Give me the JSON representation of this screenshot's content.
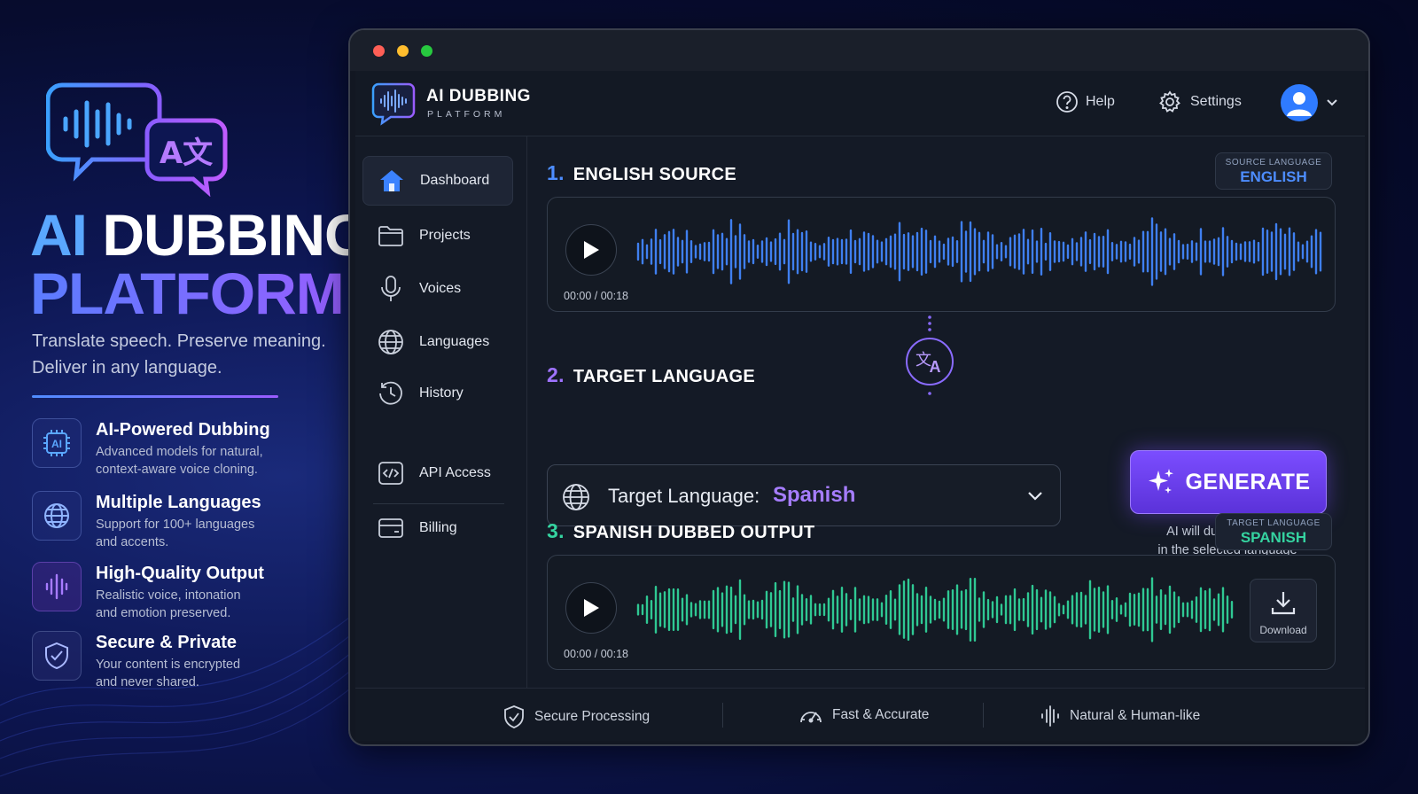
{
  "hero": {
    "title_ai": "AI",
    "title_dubbing": "DUBBING",
    "title_platform": "PLATFORM",
    "tagline_line1": "Translate speech. Preserve meaning.",
    "tagline_line2": "Deliver in any language.",
    "logo_glyph": "A文"
  },
  "features": [
    {
      "title": "AI-Powered Dubbing",
      "desc1": "Advanced models for natural,",
      "desc2": "context-aware voice cloning.",
      "icon": "ai-chip-icon"
    },
    {
      "title": "Multiple Languages",
      "desc1": "Support for 100+ languages",
      "desc2": "and accents.",
      "icon": "globe-icon"
    },
    {
      "title": "High-Quality Output",
      "desc1": "Realistic voice, intonation",
      "desc2": "and emotion preserved.",
      "icon": "waveform-icon"
    },
    {
      "title": "Secure & Private",
      "desc1": "Your content is encrypted",
      "desc2": "and never shared.",
      "icon": "shield-check-icon"
    }
  ],
  "app": {
    "brand_name": "AI DUBBING",
    "brand_sub": "PLATFORM",
    "help_label": "Help",
    "settings_label": "Settings"
  },
  "sidebar": {
    "items": [
      {
        "label": "Dashboard",
        "icon": "home-icon",
        "active": true
      },
      {
        "label": "Projects",
        "icon": "folder-icon"
      },
      {
        "label": "Voices",
        "icon": "microphone-icon"
      },
      {
        "label": "Languages",
        "icon": "globe-icon"
      },
      {
        "label": "History",
        "icon": "history-icon"
      },
      {
        "label": "API Access",
        "icon": "code-icon"
      },
      {
        "label": "Billing",
        "icon": "card-icon"
      }
    ]
  },
  "source": {
    "num": "1.",
    "title": "ENGLISH SOURCE",
    "badge_label": "SOURCE LANGUAGE",
    "badge_value": "ENGLISH",
    "time": "00:00 / 00:18"
  },
  "target": {
    "num": "2.",
    "title": "TARGET LANGUAGE",
    "select_label": "Target Language:",
    "select_value": "Spanish",
    "generate_label": "GENERATE",
    "note_line1": "AI will dub your audio",
    "note_line2": "in the selected language"
  },
  "output": {
    "num": "3.",
    "title": "SPANISH DUBBED OUTPUT",
    "badge_label": "TARGET LANGUAGE",
    "badge_value": "SPANISH",
    "time": "00:00 / 00:18",
    "download_label": "Download"
  },
  "footer": {
    "items": [
      {
        "label": "Secure Processing",
        "icon": "shield-check-icon"
      },
      {
        "label": "Fast & Accurate",
        "icon": "speedometer-icon"
      },
      {
        "label": "Natural & Human-like",
        "icon": "waveform-icon"
      }
    ]
  },
  "colors": {
    "accent_blue": "#4d8dff",
    "accent_purple": "#7b4dff",
    "accent_green": "#35d3a0",
    "source_wave": "#3f7ff0",
    "output_wave": "#2fc893"
  }
}
